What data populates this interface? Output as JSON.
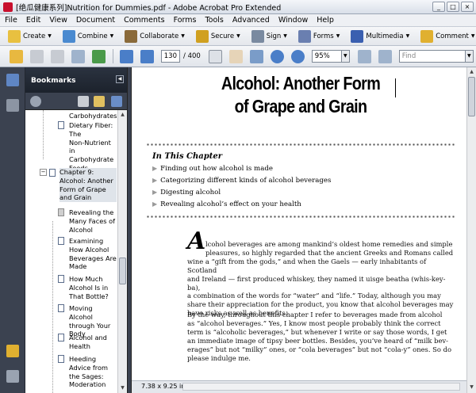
{
  "window": {
    "title": "[绝瓜健康系列]Nutrition for Dummies.pdf - Adobe Acrobat Pro Extended",
    "controls": {
      "minimize": "_",
      "maximize": "□",
      "close": "×"
    }
  },
  "menu": [
    "File",
    "Edit",
    "View",
    "Document",
    "Comments",
    "Forms",
    "Tools",
    "Advanced",
    "Window",
    "Help"
  ],
  "tasks_toolbar": [
    {
      "label": "Create",
      "icon": "create-icon",
      "color": "#e8c040"
    },
    {
      "label": "Combine",
      "icon": "combine-icon",
      "color": "#4a8ad0"
    },
    {
      "label": "Collaborate",
      "icon": "collaborate-icon",
      "color": "#8a6a3a"
    },
    {
      "label": "Secure",
      "icon": "lock-icon",
      "color": "#d0a020"
    },
    {
      "label": "Sign",
      "icon": "pen-icon",
      "color": "#7a8aa0"
    },
    {
      "label": "Forms",
      "icon": "forms-icon",
      "color": "#6a7fb0"
    },
    {
      "label": "Multimedia",
      "icon": "multimedia-icon",
      "color": "#3a5fb0"
    },
    {
      "label": "Comment",
      "icon": "comment-icon",
      "color": "#e0b030"
    }
  ],
  "nav_toolbar": {
    "page_current": "130",
    "page_total": "/ 400",
    "zoom": "95%",
    "find_placeholder": "Find"
  },
  "bookmarks": {
    "title": "Bookmarks",
    "entries": [
      {
        "text": [
          "Carbohydrates"
        ]
      },
      {
        "text": [
          "Dietary Fiber:",
          "The",
          "Non-Nutrient in",
          "Carbohydrate",
          "Foods"
        ]
      },
      {
        "text": [
          "Chapter 9:",
          "Alcohol: Another",
          "Form of Grape",
          "and Grain"
        ]
      },
      {
        "text": [
          "Revealing the",
          "Many Faces of",
          "Alcohol"
        ]
      },
      {
        "text": [
          "Examining",
          "How Alcohol",
          "Beverages Are",
          "Made"
        ]
      },
      {
        "text": [
          "How Much",
          "Alcohol Is in",
          "That Bottle?"
        ]
      },
      {
        "text": [
          "Moving Alcohol",
          "through Your",
          "Body"
        ]
      },
      {
        "text": [
          "Alcohol and",
          "Health"
        ]
      },
      {
        "text": [
          "Heeding",
          "Advice from",
          "the Sages:",
          "Moderation"
        ]
      }
    ]
  },
  "document": {
    "chapter_title_1": "Alcohol: Another Form",
    "chapter_title_2": "of Grape and Grain",
    "in_this_chapter": "In This Chapter",
    "bullets": [
      "Finding out how alcohol is made",
      "Categorizing different kinds of alcohol beverages",
      "Digesting alcohol",
      "Revealing alcohol’s effect on your health"
    ],
    "dropcap": "A",
    "p1_lines": [
      "lcohol beverages are among mankind’s oldest home remedies and simple",
      "pleasures, so highly regarded that the ancient Greeks and Romans called",
      "wine a “gift from the gods,” and when the Gaels — early inhabitants of Scotland",
      "and Ireland — first produced whiskey, they named it uisge beatha (whis-key-ba),",
      "a combination of the words for “water” and “life.” Today, although you may",
      "share their appreciation for the product, you know that alcohol beverages may",
      "have risks as well as benefits."
    ],
    "p2_lines": [
      "By the way, throughout this chapter I refer to beverages made from alcohol",
      "as “alcohol beverages.” Yes, I know most people probably think the correct",
      "term is “alcoholic beverages,” but whenever I write or say those words, I get",
      "an immediate image of tipsy beer bottles. Besides, you’ve heard of “milk bev-",
      "erages” but not “milky” ones, or “cola beverages” but not “cola-y” ones. So do",
      "please indulge me."
    ]
  },
  "status": {
    "page_size": "7.38 x 9.25 in"
  }
}
